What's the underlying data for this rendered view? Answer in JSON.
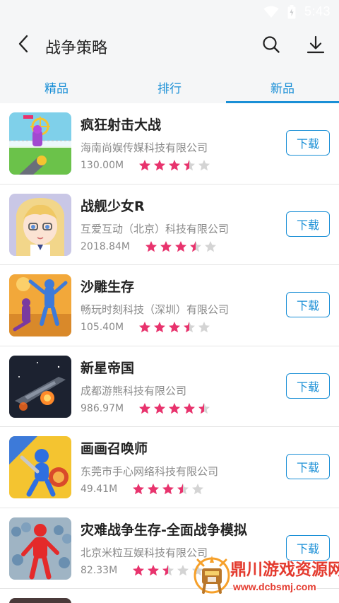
{
  "status_bar": {
    "time": "5:43"
  },
  "header": {
    "title": "战争策略"
  },
  "tabs": [
    {
      "label": "精品",
      "active": false
    },
    {
      "label": "排行",
      "active": false
    },
    {
      "label": "新品",
      "active": true
    }
  ],
  "colors": {
    "accent": "#1a8fd6",
    "star_filled": "#e8336d",
    "star_empty": "#d4d4d4"
  },
  "apps": [
    {
      "name": "疯狂射击大战",
      "developer": "海南尚娱传媒科技有限公司",
      "size": "130.00M",
      "rating": 3.5,
      "button": "下载"
    },
    {
      "name": "战舰少女R",
      "developer": "互爱互动（北京）科技有限公司",
      "size": "2018.84M",
      "rating": 3.5,
      "button": "下载"
    },
    {
      "name": "沙雕生存",
      "developer": "畅玩时刻科技（深圳）有限公司",
      "size": "105.40M",
      "rating": 3.5,
      "button": "下载"
    },
    {
      "name": "新星帝国",
      "developer": "成都游熊科技有限公司",
      "size": "986.97M",
      "rating": 4.5,
      "button": "下载"
    },
    {
      "name": "画画召唤师",
      "developer": "东莞市手心网络科技有限公司",
      "size": "49.41M",
      "rating": 3.5,
      "button": "下载"
    },
    {
      "name": "灾难战争生存-全面战争模拟",
      "developer": "北京米粒互娱科技有限公司",
      "size": "82.33M",
      "rating": 2.5,
      "button": "下载"
    }
  ],
  "watermark": {
    "title": "鼎川游戏资源网",
    "url": "www.dcbsmj.com"
  }
}
